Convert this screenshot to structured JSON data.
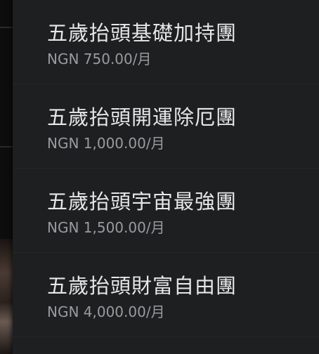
{
  "menu": {
    "items": [
      {
        "title": "五歲抬頭基礎加持團",
        "price": "NGN 750.00/月"
      },
      {
        "title": "五歲抬頭開運除厄團",
        "price": "NGN 1,000.00/月"
      },
      {
        "title": "五歲抬頭宇宙最強團",
        "price": "NGN 1,500.00/月"
      },
      {
        "title": "五歲抬頭財富自由團",
        "price": "NGN 4,000.00/月"
      }
    ]
  },
  "colors": {
    "panel_bg": "#1e1f21",
    "title_text": "#e7e7e7",
    "price_text": "#9a9b9e",
    "divider": "#252628"
  }
}
